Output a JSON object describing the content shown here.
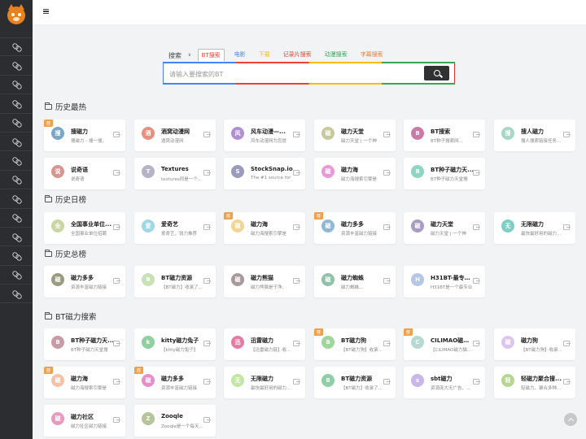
{
  "sidebar": {
    "item_count": 14
  },
  "search": {
    "label": "搜索",
    "arrow": "›",
    "tabs": [
      {
        "label": "BT搜索",
        "color": "#ea4335",
        "active": true
      },
      {
        "label": "电影",
        "color": "#4285f4"
      },
      {
        "label": "下载",
        "color": "#fbbc05"
      },
      {
        "label": "记录片搜索",
        "color": "#ea4335"
      },
      {
        "label": "动漫搜索",
        "color": "#34a853"
      },
      {
        "label": "字幕搜索",
        "color": "#f27a3c"
      }
    ],
    "placeholder": "请输入要搜索的BT"
  },
  "sections": [
    {
      "title": "历史最热",
      "cards": [
        {
          "avatar": "搜",
          "color": "#7aa7c7",
          "title": "搜磁力",
          "desc": "搜磁力 - 搜一搜，",
          "badge": "荐"
        },
        {
          "avatar": "酒",
          "color": "#e98f7c",
          "title": "酒窝动漫网",
          "desc": "酒窝动漫网"
        },
        {
          "avatar": "风",
          "color": "#b08fd6",
          "title": "风车动漫—...",
          "desc": "风车动漫网为您提"
        },
        {
          "avatar": "磁",
          "color": "#c9c79c",
          "title": "磁力天堂",
          "desc": "磁力天堂 | 一个神"
        },
        {
          "avatar": "B",
          "color": "#c97aa6",
          "title": "BT搜索",
          "desc": "BT种子搜索网..."
        },
        {
          "avatar": "搜",
          "color": "#a7d7c7",
          "title": "搜人磁力",
          "desc": "搜人搜索链接任务..."
        },
        {
          "avatar": "说",
          "color": "#d4968e",
          "title": "说奇语",
          "desc": "说奇语"
        },
        {
          "avatar": "T",
          "color": "#b7b3c7",
          "title": "Textures",
          "desc": "textures同是一个..."
        },
        {
          "avatar": "S",
          "color": "#9a9bbf",
          "title": "StockSnap.io",
          "desc": "The #1 source for"
        },
        {
          "avatar": "磁",
          "color": "#e99ad6",
          "title": "磁力海",
          "desc": "磁力海搜索引擎是"
        },
        {
          "avatar": "B",
          "color": "#8fd6c2",
          "title": "BT种子磁力天...",
          "desc": "BT种子磁力天堂搜"
        }
      ]
    },
    {
      "title": "历史日榜",
      "cards": [
        {
          "avatar": "全",
          "color": "#c9d6a3",
          "title": "全国事业单位...",
          "desc": "全国事业单位招聘"
        },
        {
          "avatar": "爱",
          "color": "#9ed8e6",
          "title": "爱奇艺",
          "desc": "爱奇艺，钱力推荐"
        },
        {
          "avatar": "磁",
          "color": "#f2d591",
          "title": "磁力海",
          "desc": "磁力海搜索引擎是",
          "badge": "荐"
        },
        {
          "avatar": "磁",
          "color": "#8fb7d6",
          "title": "磁力多多",
          "desc": "资源丰富磁力链接",
          "badge": "荐"
        },
        {
          "avatar": "磁",
          "color": "#a99bc2",
          "title": "磁力天堂",
          "desc": "磁力天堂 | 一个神"
        },
        {
          "avatar": "无",
          "color": "#7ccfc5",
          "title": "无限磁力",
          "desc": "最快最好用的磁力..."
        }
      ]
    },
    {
      "title": "历史总榜",
      "cards": [
        {
          "avatar": "磁",
          "color": "#9b9b7f",
          "title": "磁力多多",
          "desc": "资源丰富磁力链接"
        },
        {
          "avatar": "B",
          "color": "#c8e2b8",
          "title": "BT磁力资源",
          "desc": "【BT磁力】收录了..."
        },
        {
          "avatar": "磁",
          "color": "#a89a9a",
          "title": "磁力熊猫",
          "desc": "磁力熊猫是于净、"
        },
        {
          "avatar": "磁",
          "color": "#8fc2a8",
          "title": "磁力蜘蛛",
          "desc": "磁力蜘蛛..."
        },
        {
          "avatar": "H",
          "color": "#b4c8e6",
          "title": "H31BT-最专业...",
          "desc": "H31BT是一个最专业"
        }
      ]
    },
    {
      "title": "BT磁力搜索",
      "cards": [
        {
          "avatar": "B",
          "color": "#c99aa8",
          "title": "BT种子磁力天...",
          "desc": "BT种子磁力天堂搜"
        },
        {
          "avatar": "k",
          "color": "#8fcfa0",
          "title": "kitty磁力兔子",
          "desc": "【kitty磁力兔子】"
        },
        {
          "avatar": "迅",
          "color": "#e87aa2",
          "title": "迅雷磁力",
          "desc": "【迅雷磁力链】收..."
        },
        {
          "avatar": "B",
          "color": "#9fd69a",
          "title": "BT磁力狗",
          "desc": "【BT磁力狗】收录...",
          "badge": "荐"
        },
        {
          "avatar": "C",
          "color": "#b7d9d2",
          "title": "CILIMAO磁力猫",
          "desc": "【CILIMAO磁力猫】...",
          "badge": "荐"
        },
        {
          "avatar": "磁",
          "color": "#dcc4ef",
          "title": "磁力狗",
          "desc": "【BT磁力狗】收录..."
        },
        {
          "avatar": "磁",
          "color": "#f2c3a8",
          "title": "磁力海",
          "desc": "磁力海搜索引擎是",
          "badge": "荐"
        },
        {
          "avatar": "磁",
          "color": "#e58fc8",
          "title": "磁力多多",
          "desc": "资源丰富磁力链接",
          "badge": "荐"
        },
        {
          "avatar": "无",
          "color": "#c2e6a3",
          "title": "无限磁力",
          "desc": "最快最好用的磁力..."
        },
        {
          "avatar": "B",
          "color": "#8fcfa6",
          "title": "BT磁力资源",
          "desc": "【BT磁力】收录了..."
        },
        {
          "avatar": "s",
          "color": "#c9b7ea",
          "title": "sbt磁力",
          "desc": "资源庞大无广告，..."
        },
        {
          "avatar": "轻",
          "color": "#b6d68f",
          "title": "轻磁力聚合搜...",
          "desc": "轻磁力，聚合多种..."
        },
        {
          "avatar": "磁",
          "color": "#e69ac0",
          "title": "磁力社区",
          "desc": "磁力社区磁力链接"
        },
        {
          "avatar": "Z",
          "color": "#b5c49a",
          "title": "Zooqle",
          "desc": "Zooqle是一个每天..."
        }
      ]
    }
  ]
}
